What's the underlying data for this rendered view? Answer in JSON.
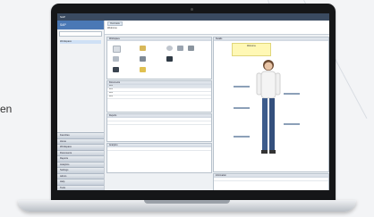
{
  "side_text": "en",
  "app": {
    "title_bar": "SAP",
    "logo": "SAP",
    "nav_tree_item": "Workspace",
    "nav_sections": [
      "Favorites",
      "Home",
      "Workspace",
      "Documents",
      "Reports",
      "Analytics",
      "Settings",
      "Admin",
      "Help",
      "Tools"
    ],
    "tab": "Overview",
    "content_text": "Welcome",
    "panels": {
      "top_left": "Workspace",
      "mid_left": "Documents",
      "lower_left": "Reports",
      "bottom_left": "Analytics",
      "right": "Details",
      "bottom_right": "Information"
    },
    "notice_text": "Welcome",
    "table_rows": [
      "Item",
      "Item",
      "Item",
      "Item"
    ]
  }
}
